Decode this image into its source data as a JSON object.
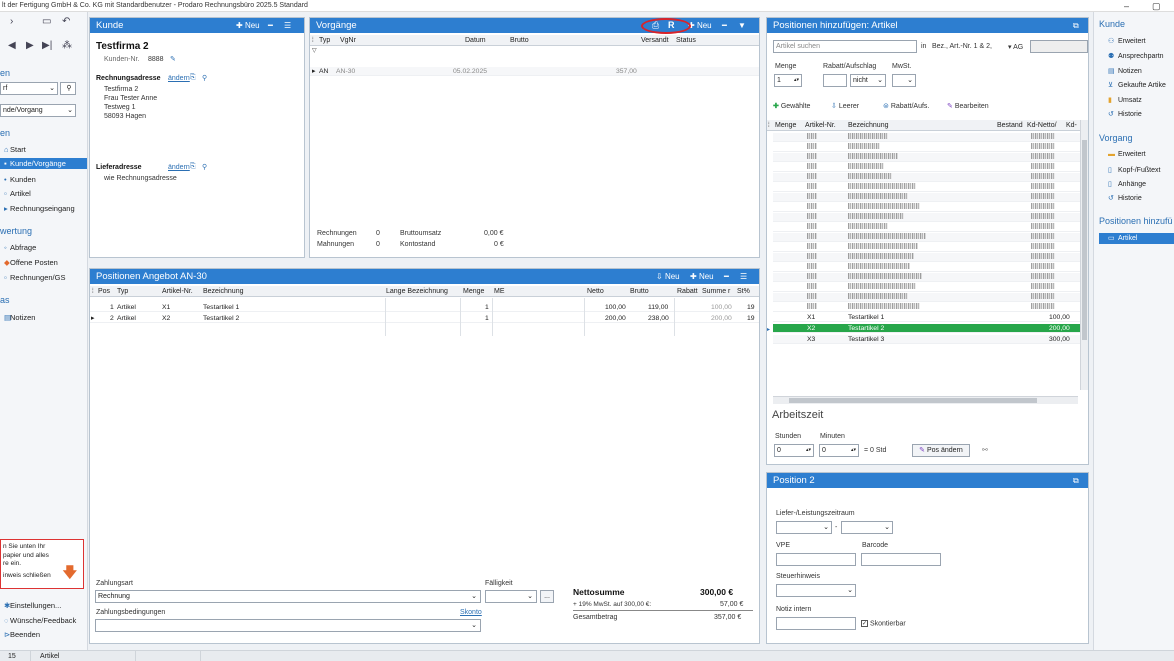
{
  "window": {
    "title": "lt der Fertigung GmbH & Co. KG mit Standardbenutzer  -  Prodaro Rechnungsbüro 2025.5 Standard",
    "minimize": "–",
    "maximize": "▢"
  },
  "leftnav": {
    "heading_top": "en",
    "search_select": "rf",
    "category_select": "nde/Vorgang",
    "section_label": "en",
    "items": [
      {
        "label": "Start",
        "icon": "home-icon"
      },
      {
        "label": "Kunde/Vorgänge",
        "icon": "folder-icon",
        "selected": true
      },
      {
        "label": "Kunden",
        "icon": "person-icon"
      },
      {
        "label": "Artikel",
        "icon": "box-icon"
      },
      {
        "label": "Rechnungseingang",
        "icon": "inbox-icon"
      }
    ],
    "section2": "wertung",
    "items2": [
      {
        "label": "Abfrage",
        "icon": "query-icon"
      },
      {
        "label": "Offene Posten",
        "icon": "open-items-icon"
      },
      {
        "label": "Rechnungen/GS",
        "icon": "invoice-icon"
      }
    ],
    "section3": "as",
    "items3": [
      {
        "label": "Notizen",
        "icon": "notes-icon"
      }
    ],
    "hint": {
      "line1": "n Sie unten Ihr",
      "line2": "papier und alles",
      "line3": "re ein.",
      "close": "inweis schließen"
    },
    "footer": [
      {
        "label": "Einstellungen...",
        "icon": "gear-icon"
      },
      {
        "label": "Wünsche/Feedback",
        "icon": "feedback-icon"
      },
      {
        "label": "Beenden",
        "icon": "exit-icon"
      }
    ]
  },
  "kunde": {
    "title": "Kunde",
    "new_label": "Neu",
    "name": "Testfirma 2",
    "kundennr_label": "Kunden-Nr.",
    "kundennr": "8888",
    "rechnungsadresse_label": "Rechnungsadresse",
    "aendern": "ändern",
    "address": [
      "Testfirma 2",
      "Frau Tester Anne",
      "Testweg 1",
      "58093 Hagen"
    ],
    "lieferadresse_label": "Lieferadresse",
    "lieferadresse_value": "wie Rechnungsadresse"
  },
  "vorgaenge": {
    "title": "Vorgänge",
    "r_label": "R",
    "new_label": "Neu",
    "columns": [
      "Typ",
      "VgNr",
      "Datum",
      "Brutto",
      "Versandt",
      "Status"
    ],
    "rows": [
      {
        "typ": "AN",
        "vgnr": "AN-30",
        "datum": "05.02.2025",
        "brutto": "357,00"
      }
    ],
    "rechnungen_label": "Rechnungen",
    "rechnungen_count": "0",
    "bruttoumsatz_label": "Bruttoumsatz",
    "bruttoumsatz": "0,00 €",
    "mahnungen_label": "Mahnungen",
    "mahnungen_count": "0",
    "kontostand_label": "Kontostand",
    "kontostand": "0 €"
  },
  "positionen": {
    "title": "Positionen Angebot AN-30",
    "new1": "Neu",
    "new2": "Neu",
    "columns": [
      "Pos",
      "Typ",
      "Artikel-Nr.",
      "Bezeichnung",
      "Lange Bezeichnung",
      "Menge",
      "ME",
      "Netto",
      "Brutto",
      "Rabatt",
      "Summe r",
      "St%"
    ],
    "rows": [
      {
        "pos": "1",
        "typ": "Artikel",
        "artnr": "X1",
        "bez": "Testartikel 1",
        "menge": "1",
        "netto": "100,00",
        "brutto": "119,00",
        "summe": "100,00",
        "st": "19"
      },
      {
        "pos": "2",
        "typ": "Artikel",
        "artnr": "X2",
        "bez": "Testartikel 2",
        "menge": "1",
        "netto": "200,00",
        "brutto": "238,00",
        "summe": "200,00",
        "st": "19"
      }
    ],
    "zahlungsart_label": "Zahlungsart",
    "zahlungsart": "Rechnung",
    "faelligkeit_label": "Fälligkeit",
    "zahlungsbed_label": "Zahlungsbedingungen",
    "skonto_label": "Skonto",
    "ellipsis": "...",
    "nettosumme_label": "Nettosumme",
    "nettosumme": "300,00 €",
    "mwst_label": "+ 19% MwSt. auf 300,00 €:",
    "mwst": "57,00 €",
    "gesamt_label": "Gesamtbetrag",
    "gesamt": "357,00 €"
  },
  "artikel": {
    "title": "Positionen hinzufügen: Artikel",
    "search_placeholder": "Artikel suchen",
    "in_label": "in",
    "search_scope": "Bez., Art.-Nr. 1 & 2,",
    "ag_label": "▾ AG",
    "menge_label": "Menge",
    "rabatt_label": "Rabatt/Aufschlag",
    "mwst_label": "MwSt.",
    "menge_value": "1",
    "nicht_label": "nicht",
    "btn_gewaehlte": "Gewählte",
    "btn_leerer": "Leerer",
    "btn_rabatt": "Rabatt/Aufs.",
    "btn_bearbeiten": "Bearbeiten",
    "columns": [
      "Menge",
      "Artikel-Nr.",
      "Bezeichnung",
      "Bestand",
      "Kd-Netto/",
      "Kd-"
    ],
    "rows": [
      {
        "nr": "X1",
        "bez": "Testartikel 1",
        "netto": "100,00"
      },
      {
        "nr": "X2",
        "bez": "Testartikel 2",
        "netto": "200,00",
        "selected": true
      },
      {
        "nr": "X3",
        "bez": "Testartikel 3",
        "netto": "300,00"
      }
    ],
    "arbeitszeit_label": "Arbeitszeit",
    "stunden_label": "Stunden",
    "minuten_label": "Minuten",
    "stunden_value": "0",
    "minuten_value": "0",
    "std_label": "= 0 Std",
    "pos_aendern": "Pos ändern"
  },
  "position2": {
    "title": "Position 2",
    "liefer_label": "Liefer-/Leistungszeitraum",
    "dash": "-",
    "vpe_label": "VPE",
    "barcode_label": "Barcode",
    "steuer_label": "Steuerhinweis",
    "notiz_label": "Notiz intern",
    "skontierbar_label": "Skontierbar",
    "skontierbar_check": "✓"
  },
  "rightnav": {
    "kunde_head": "Kunde",
    "kunde_items": [
      {
        "label": "Erweitert",
        "icon": "people-icon"
      },
      {
        "label": "Ansprechpartn",
        "icon": "contact-icon"
      },
      {
        "label": "Notizen",
        "icon": "notes-icon"
      },
      {
        "label": "Gekaufte Artike",
        "icon": "cart-icon"
      },
      {
        "label": "Umsatz",
        "icon": "chart-icon"
      },
      {
        "label": "Historie",
        "icon": "history-icon"
      }
    ],
    "vorgang_head": "Vorgang",
    "vorgang_items": [
      {
        "label": "Erweitert",
        "icon": "folder-icon"
      },
      {
        "label": "Kopf-/Fußtext",
        "icon": "document-icon"
      },
      {
        "label": "Anhänge",
        "icon": "attachment-icon"
      },
      {
        "label": "Historie",
        "icon": "history-icon"
      }
    ],
    "positionen_head": "Positionen hinzufü",
    "positionen_items": [
      {
        "label": "Artikel",
        "icon": "article-icon",
        "selected": true
      }
    ]
  },
  "status": {
    "left": "15",
    "right": "Artikel"
  }
}
